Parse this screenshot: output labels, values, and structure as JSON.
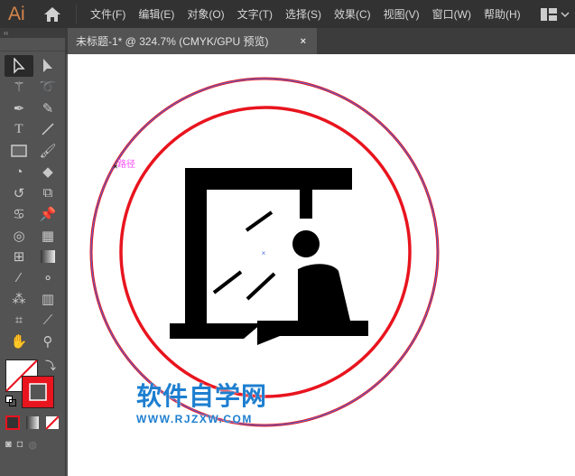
{
  "app": {
    "logo": "Ai"
  },
  "menu": [
    "文件(F)",
    "编辑(E)",
    "对象(O)",
    "文字(T)",
    "选择(S)",
    "效果(C)",
    "视图(V)",
    "窗口(W)",
    "帮助(H)"
  ],
  "document_tab": {
    "title": "未标题-1* @ 324.7% (CMYK/GPU 预览)",
    "close": "×"
  },
  "toolbar": {
    "collapse": "‹‹"
  },
  "canvas": {
    "path_label": "路径",
    "watermark_title": "软件自学网",
    "watermark_url": "WWW.RJZXW.COM"
  },
  "colors": {
    "red": "#e8141e",
    "selection_blue": "#4a6ee0",
    "path_label": "#ff4dff",
    "watermark": "#1e7fd0"
  }
}
